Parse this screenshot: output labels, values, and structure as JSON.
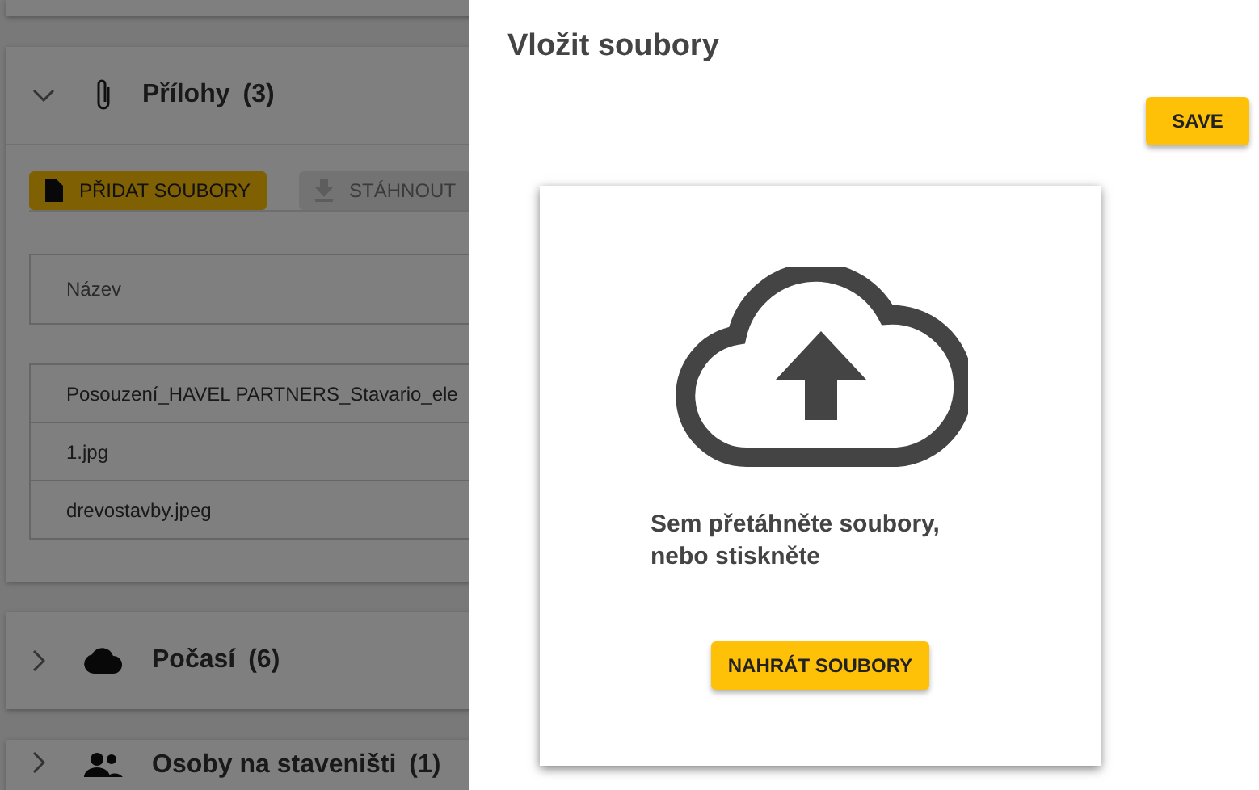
{
  "background_page": {
    "attachments_panel": {
      "title": "Přílohy",
      "count": "(3)",
      "expanded": true,
      "buttons": [
        {
          "label": "PŘIDAT SOUBORY",
          "disabled": false
        },
        {
          "label": "STÁHNOUT",
          "disabled": true
        }
      ],
      "table": {
        "columns": [
          "Název"
        ],
        "rows": [
          "Posouzení_HAVEL PARTNERS_Stavario_ele",
          "1.jpg",
          "drevostavby.jpeg"
        ]
      }
    },
    "panels": [
      {
        "title": "Počasí",
        "count": "(6)",
        "kind": "weather",
        "expanded": false
      },
      {
        "title": "Osoby na staveništi",
        "count": "(1)",
        "kind": "people",
        "expanded": false
      }
    ]
  },
  "drawer": {
    "title": "Vložit soubory",
    "save_button": "SAVE",
    "dropzone": {
      "text": "Sem přetáhněte soubory, nebo stiskněte",
      "button": "NAHRÁT SOUBORY"
    }
  }
}
